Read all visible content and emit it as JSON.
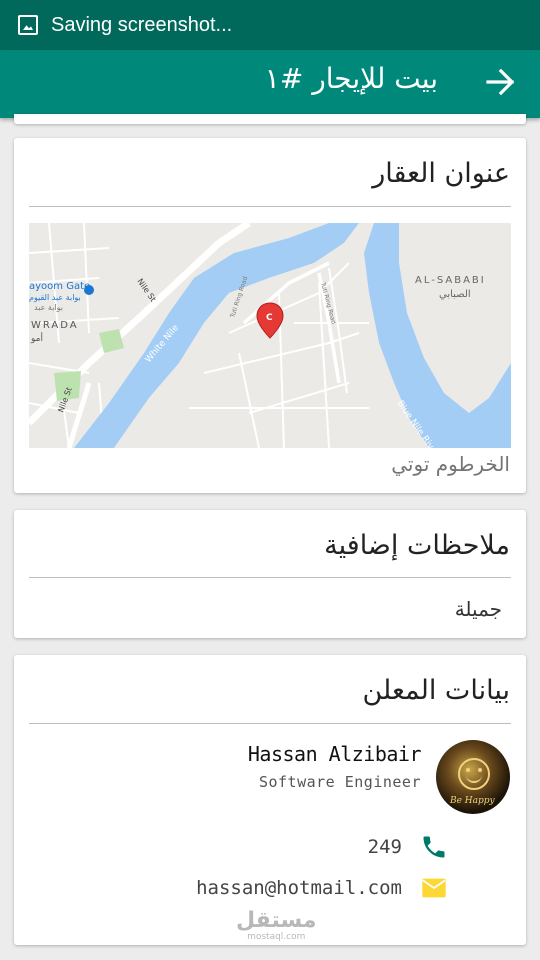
{
  "status_bar": {
    "text": "Saving screenshot..."
  },
  "app_bar": {
    "title": "بيت للإيجار #١"
  },
  "address_card": {
    "title": "عنوان العقار",
    "address": "الخرطوم توتي",
    "map": {
      "labels": {
        "sababi_en": "AL-SABABI",
        "sababi_ar": "الصبابي",
        "wrada": "WRADA",
        "wrada_ar": "أمو",
        "gate_en": "ayoom Gate",
        "gate_ar": "بوابة عبد القيوم",
        "gate_ar2": "بوابة عبد",
        "nile_st_1": "Nile St",
        "nile_st_2": "Nile St",
        "white_nile": "White Nile",
        "blue_nile": "Blue Nile Riv",
        "tuti_ring_1": "Tuti Ring Road",
        "tuti_ring_2": "Tuti Ring Road",
        "marker": "C"
      },
      "colors": {
        "water": "#a3cdf5",
        "land": "#eceae6",
        "park": "#bde2b0",
        "road": "#ffffff",
        "marker": "#e53935"
      }
    }
  },
  "notes_card": {
    "title": "ملاحظات إضافية",
    "note": "جميلة"
  },
  "advertiser_card": {
    "title": "بيانات المعلن",
    "name": "Hassan Alzibair",
    "role": "Software Engineer",
    "avatar_caption": "Be Happy",
    "phone": "249",
    "email": "hassan@hotmail.com"
  },
  "watermark": {
    "ar": "مستقل",
    "en": "mostaql.com"
  },
  "colors": {
    "status_bar": "#00695c",
    "app_bar": "#00897b",
    "phone_icon": "#00796b",
    "email_icon": "#fdd835"
  }
}
